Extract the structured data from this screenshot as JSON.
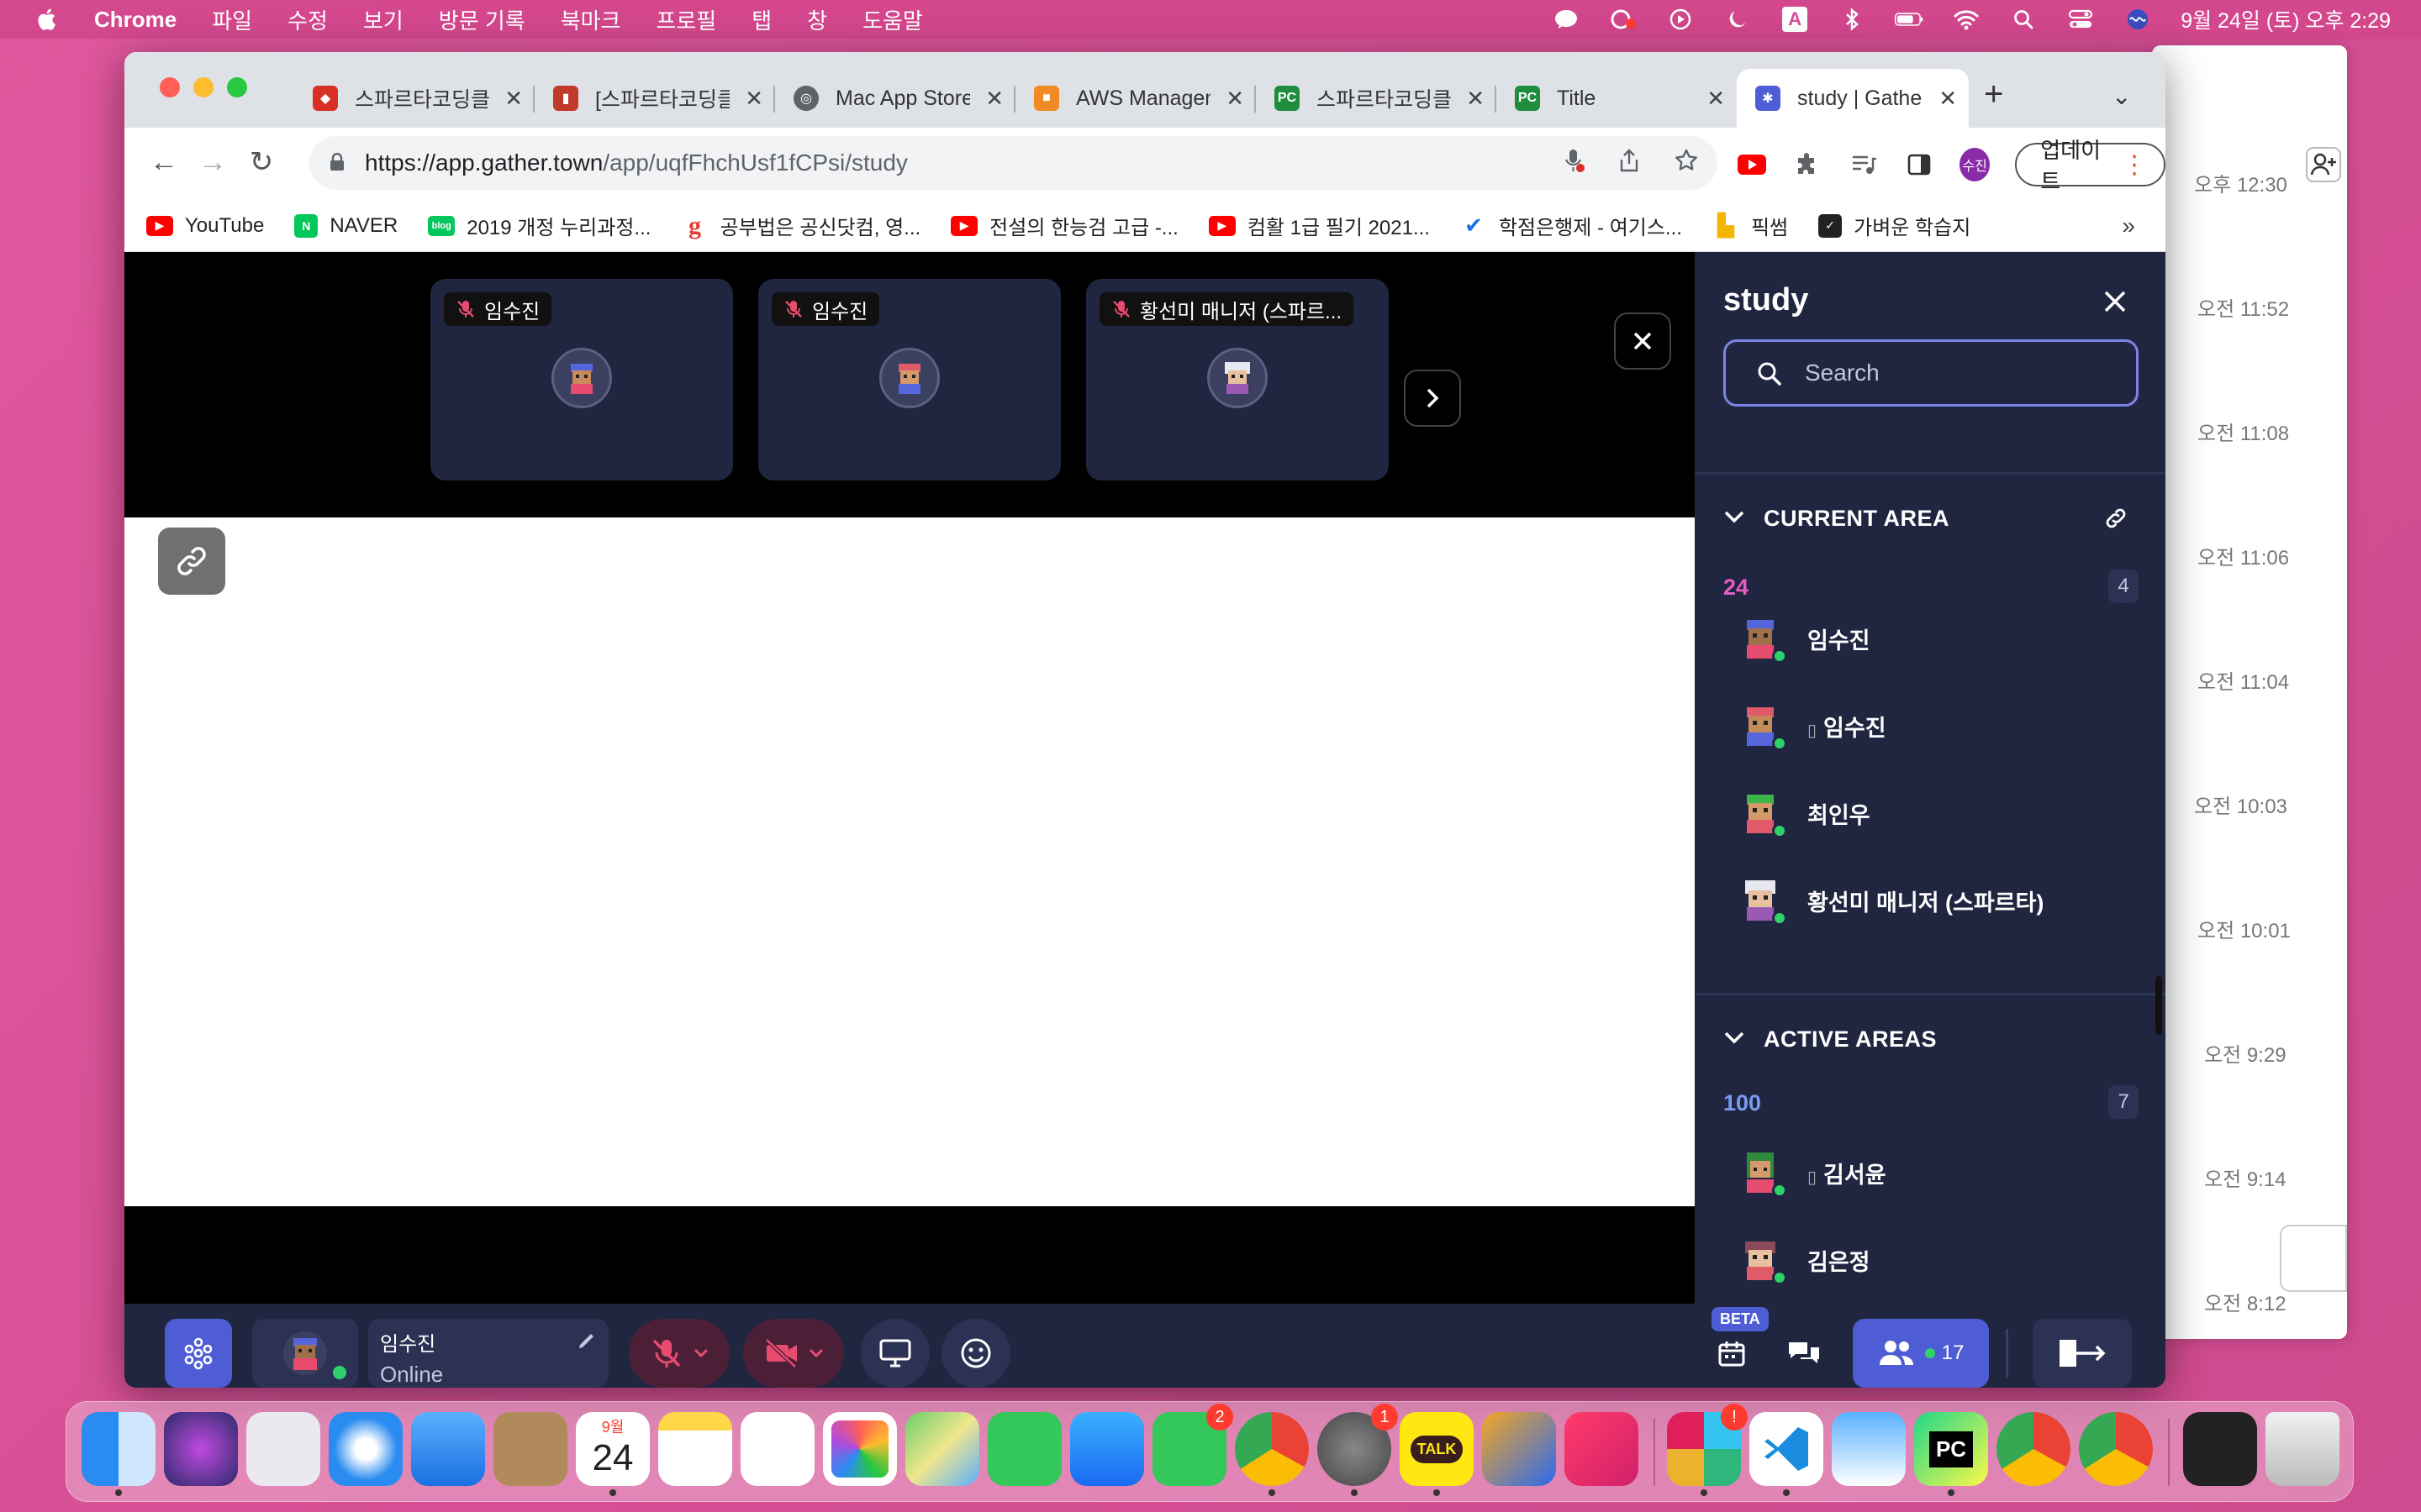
{
  "menubar": {
    "app": "Chrome",
    "menus": [
      "파일",
      "수정",
      "보기",
      "방문 기록",
      "북마크",
      "프로필",
      "탭",
      "창",
      "도움말"
    ],
    "input_source": "A",
    "clock": "9월 24일 (토) 오후 2:29"
  },
  "bg_window": {
    "timestamps": [
      "오후 12:30",
      "오전 11:52",
      "오전 11:08",
      "오전 11:06",
      "오전 11:04",
      "오전 10:03",
      "오전 10:01",
      "오전 9:29",
      "오전 9:14",
      "오전 8:12"
    ]
  },
  "browser": {
    "tabs": [
      {
        "title": "스파르타코딩클럽",
        "color": "#d93025"
      },
      {
        "title": "[스파르타코딩클럽",
        "color": "#c0392b"
      },
      {
        "title": "Mac App Store",
        "color": "#5f6368"
      },
      {
        "title": "AWS Managem",
        "color": "#f08a24"
      },
      {
        "title": "스파르타코딩클럽",
        "color": "#1e8e3e"
      },
      {
        "title": "Title",
        "color": "#1e8e3e"
      },
      {
        "title": "study | Gather",
        "color": "#4f5dd4"
      }
    ],
    "new_tab": "+",
    "url_host": "https://app.gather.town",
    "url_path": "/app/uqfFhchUsf1fCPsi/study",
    "profile_initial": "수진",
    "update_label": "업데이트",
    "bookmarks": [
      {
        "label": "YouTube",
        "color": "#ff0000"
      },
      {
        "label": "NAVER",
        "color": "#03c75a",
        "glyph": "N"
      },
      {
        "label": "2019 개정 누리과정...",
        "color": "#03c75a",
        "glyph": "blog"
      },
      {
        "label": "공부법은 공신닷컴, 영...",
        "color": "#e53935",
        "glyph": "g"
      },
      {
        "label": "전설의 한능검 고급 -...",
        "color": "#ff0000"
      },
      {
        "label": "컴활 1급 필기 2021...",
        "color": "#ff0000"
      },
      {
        "label": "학점은행제 - 여기스...",
        "color": "#1a73e8"
      },
      {
        "label": "픽썸",
        "color": "#f4b400"
      },
      {
        "label": "가벼운 학습지",
        "color": "#222222"
      }
    ],
    "bookmarks_more": "»"
  },
  "gather": {
    "video_tiles": [
      {
        "name": "임수진"
      },
      {
        "name": "임수진"
      },
      {
        "name": "황선미 매니저 (스파르..."
      }
    ],
    "sidebar": {
      "title": "study",
      "search_placeholder": "Search",
      "current_area_label": "CURRENT AREA",
      "current_area_name": "24",
      "current_area_count": "4",
      "current_members": [
        {
          "name": "임수진",
          "phone": false
        },
        {
          "name": "임수진",
          "phone": true
        },
        {
          "name": "최인우",
          "phone": false
        },
        {
          "name": "황선미 매니저 (스파르타)",
          "phone": false
        }
      ],
      "active_areas_label": "ACTIVE AREAS",
      "active_area_name": "100",
      "active_area_count": "7",
      "active_members": [
        {
          "name": "김서윤",
          "phone": true
        },
        {
          "name": "김은정",
          "phone": false
        }
      ]
    },
    "bottom": {
      "user_name": "임수진",
      "user_status": "Online",
      "beta": "BETA",
      "people_count": "17"
    }
  },
  "dock": {
    "badges": {
      "facetime": "2",
      "settings": "1",
      "slack": "!"
    },
    "calendar_month": "9월",
    "calendar_day": "24",
    "kakao": "TALK"
  }
}
